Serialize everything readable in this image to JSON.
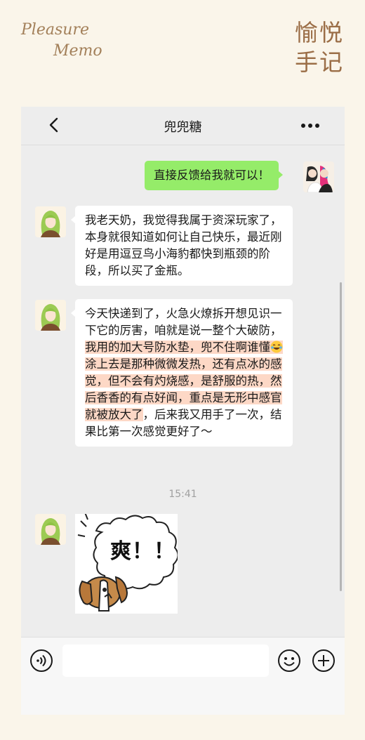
{
  "brand": {
    "en_line1": "Pleasure",
    "en_line2": "Memo",
    "cn_line1": "愉悦",
    "cn_line2": "手记"
  },
  "chat": {
    "title": "兜兜糖",
    "timestamp": "15:41",
    "messages": [
      {
        "side": "right",
        "text": "直接反馈给我就可以！"
      },
      {
        "side": "left",
        "text": "我老天奶，我觉得我属于资深玩家了，本身就很知道如何让自己快乐，最近刚好是用逗豆鸟小海豹都快到瓶颈的阶段，所以买了金瓶。"
      },
      {
        "side": "left",
        "seg1": "今天快递到了，火急火燎拆开想见识一下它的厉害，咱就是说一整个大破防，",
        "seg2": "我用的加大号防水垫，兜不住啊谁懂",
        "seg3": "涂上去是那种微微发热，还有点冰的感觉，但不会有灼烧感，是舒服的热，然后香香的有点好闻，重点是无形中感官就被放大了",
        "seg4": "，后来我又用手了一次，结果比第一次感觉更好了～"
      },
      {
        "side": "left",
        "sticker_text": "爽！！"
      }
    ]
  },
  "input": {
    "placeholder": ""
  },
  "colors": {
    "background": "#faf5ea",
    "brand": "#9b6e47",
    "bubble_self": "#95ec69",
    "bubble_other": "#ffffff",
    "highlight": "#fdd8c6",
    "chat_bg": "#ededed"
  },
  "icons": {
    "back": "chevron-left-icon",
    "more": "more-dots-icon",
    "voice": "voice-icon",
    "emoji": "smiley-icon",
    "plus": "plus-circle-icon",
    "inline_emoji": "laughing-tears-emoji"
  }
}
